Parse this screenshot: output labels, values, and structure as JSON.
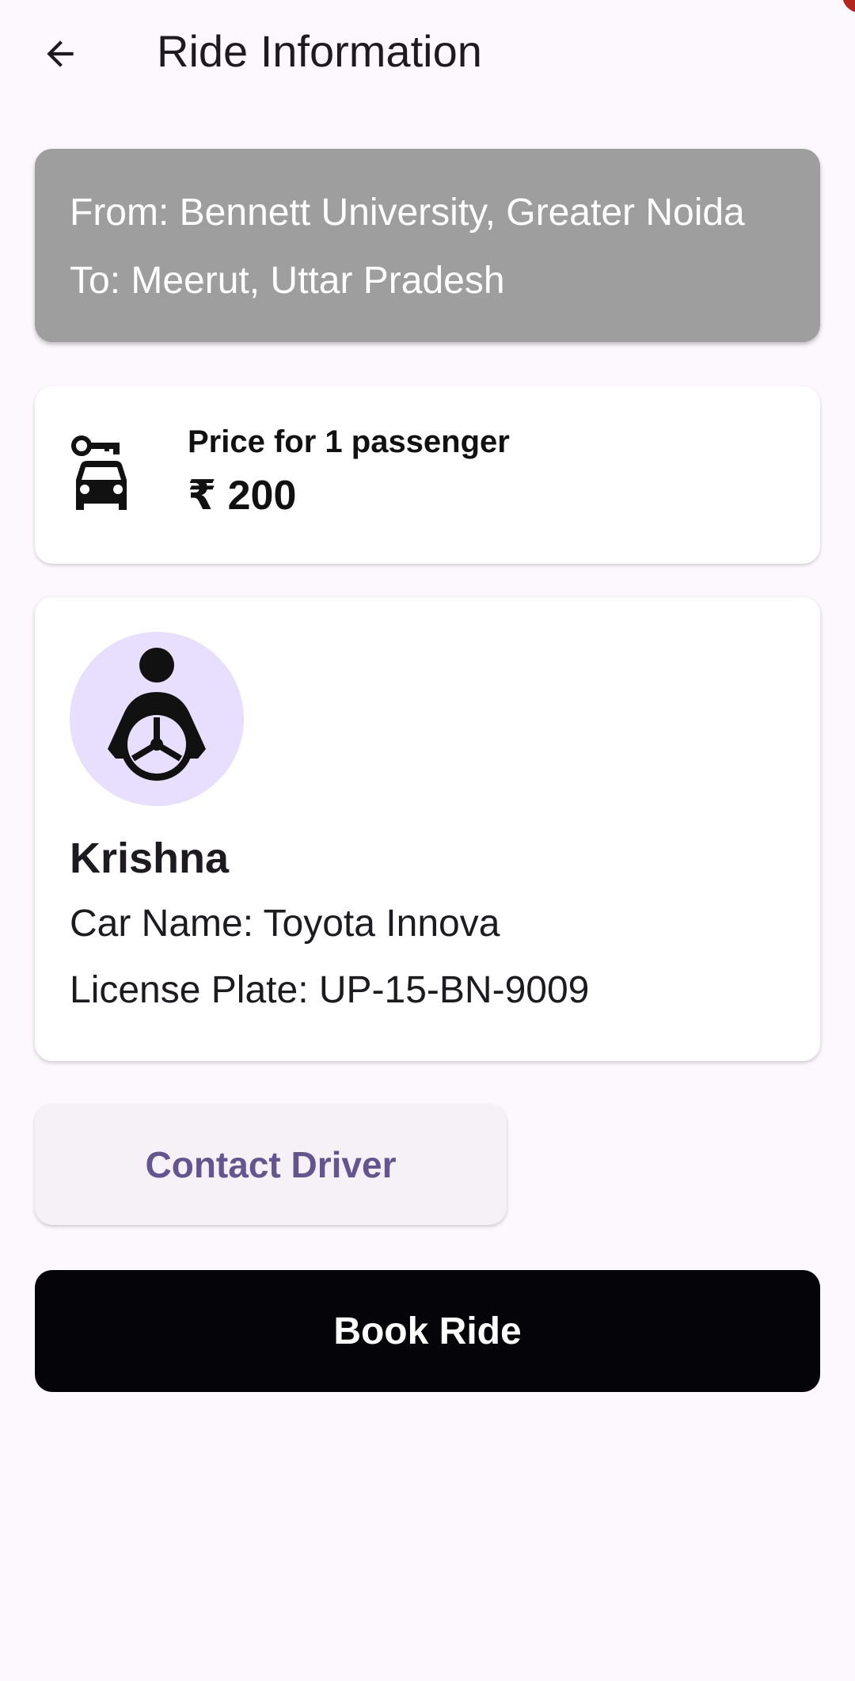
{
  "app_bar": {
    "title": "Ride Information",
    "back_icon": "arrow-back-icon"
  },
  "route": {
    "from_text": "From: Bennett University, Greater Noida",
    "to_text": "To: Meerut, Uttar Pradesh"
  },
  "price": {
    "icon": "car-rental-icon",
    "label": "Price for 1 passenger",
    "value": "₹ 200"
  },
  "driver": {
    "avatar_icon": "driver-steering-wheel-icon",
    "name": "Krishna",
    "car_name_text": "Car Name: Toyota Innova",
    "license_plate_text": "License Plate: UP-15-BN-9009"
  },
  "actions": {
    "contact_label": "Contact Driver",
    "book_label": "Book Ride"
  },
  "colors": {
    "background": "#fcf8fd",
    "route_card": "#9e9e9e",
    "avatar_bg": "#e8defd",
    "contact_text": "#65558f",
    "book_button": "#050409"
  }
}
